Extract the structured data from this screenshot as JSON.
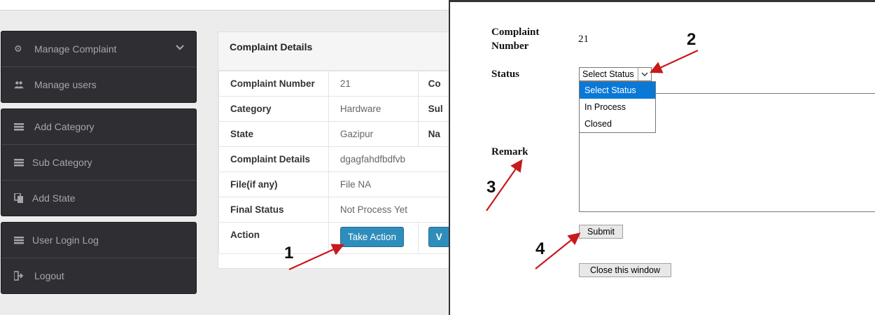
{
  "sidebar": {
    "groups": [
      [
        {
          "label": "Manage Complaint",
          "icon": "gear-icon",
          "has_chevron": true
        },
        {
          "label": "Manage users",
          "icon": "users-icon"
        }
      ],
      [
        {
          "label": "Add Category",
          "icon": "list-icon"
        },
        {
          "label": "Sub Category",
          "icon": "list-icon"
        },
        {
          "label": "Add State",
          "icon": "copy-icon"
        }
      ],
      [
        {
          "label": "User Login Log",
          "icon": "list-icon"
        },
        {
          "label": "Logout",
          "icon": "sign-out-icon"
        }
      ]
    ]
  },
  "panel": {
    "title": "Complaint Details",
    "rows": [
      {
        "key": "Complaint Number",
        "value": "21",
        "extra": "Co"
      },
      {
        "key": "Category",
        "value": "Hardware",
        "extra": "Sul"
      },
      {
        "key": "State",
        "value": "Gazipur",
        "extra": "Na"
      },
      {
        "key": "Complaint Details",
        "value": "dgagfahdfbdfvb",
        "extra": ""
      },
      {
        "key": "File(if any)",
        "value": "File NA",
        "extra": ""
      },
      {
        "key": "Final Status",
        "value": "Not Process Yet",
        "extra": ""
      },
      {
        "key": "Action",
        "value": "",
        "extra": ""
      }
    ],
    "take_action_label": "Take Action",
    "view_label_partial": "V"
  },
  "popup": {
    "complaint_number_label_1": "Complaint",
    "complaint_number_label_2": "Number",
    "complaint_number_value": "21",
    "status_label": "Status",
    "status_selected": "Select Status",
    "status_options": [
      "Select Status",
      "In Process",
      "Closed"
    ],
    "remark_label": "Remark",
    "submit_label": "Submit",
    "close_label": "Close this window"
  },
  "annotations": {
    "numbers": [
      "1",
      "2",
      "3",
      "4"
    ],
    "arrow_color": "#c8191c"
  },
  "colors": {
    "sidebar_bg": "#2f2f33",
    "button_blue": "#2e8dbb",
    "dropdown_highlight": "#0a78d7"
  }
}
